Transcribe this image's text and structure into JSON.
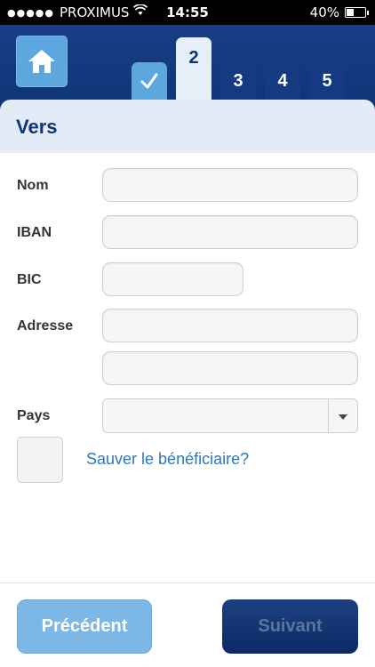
{
  "status_bar": {
    "carrier": "PROXIMUS",
    "signal_dots": "●●●●●",
    "time": "14:55",
    "battery_percent": "40%",
    "battery_level": 0.4
  },
  "header": {
    "home_icon": "home-icon",
    "steps": [
      {
        "label": "",
        "state": "done",
        "icon": "check-icon"
      },
      {
        "label": "2",
        "state": "active"
      },
      {
        "label": "3",
        "state": "pending"
      },
      {
        "label": "4",
        "state": "pending"
      },
      {
        "label": "5",
        "state": "pending"
      }
    ]
  },
  "form": {
    "title": "Vers",
    "labels": {
      "name": "Nom",
      "iban": "IBAN",
      "bic": "BIC",
      "address": "Adresse",
      "country": "Pays"
    },
    "values": {
      "name": "",
      "iban": "",
      "bic": "",
      "address_line1": "",
      "address_line2": "",
      "country": ""
    },
    "save_beneficiary_label": "Sauver le bénéficiaire?",
    "save_beneficiary_checked": false
  },
  "footer": {
    "prev_label": "Précédent",
    "next_label": "Suivant"
  },
  "colors": {
    "header_bg": "#0f3478",
    "accent_light": "#5da7df",
    "link": "#2a78c0",
    "card_head": "#e3ecf6"
  }
}
